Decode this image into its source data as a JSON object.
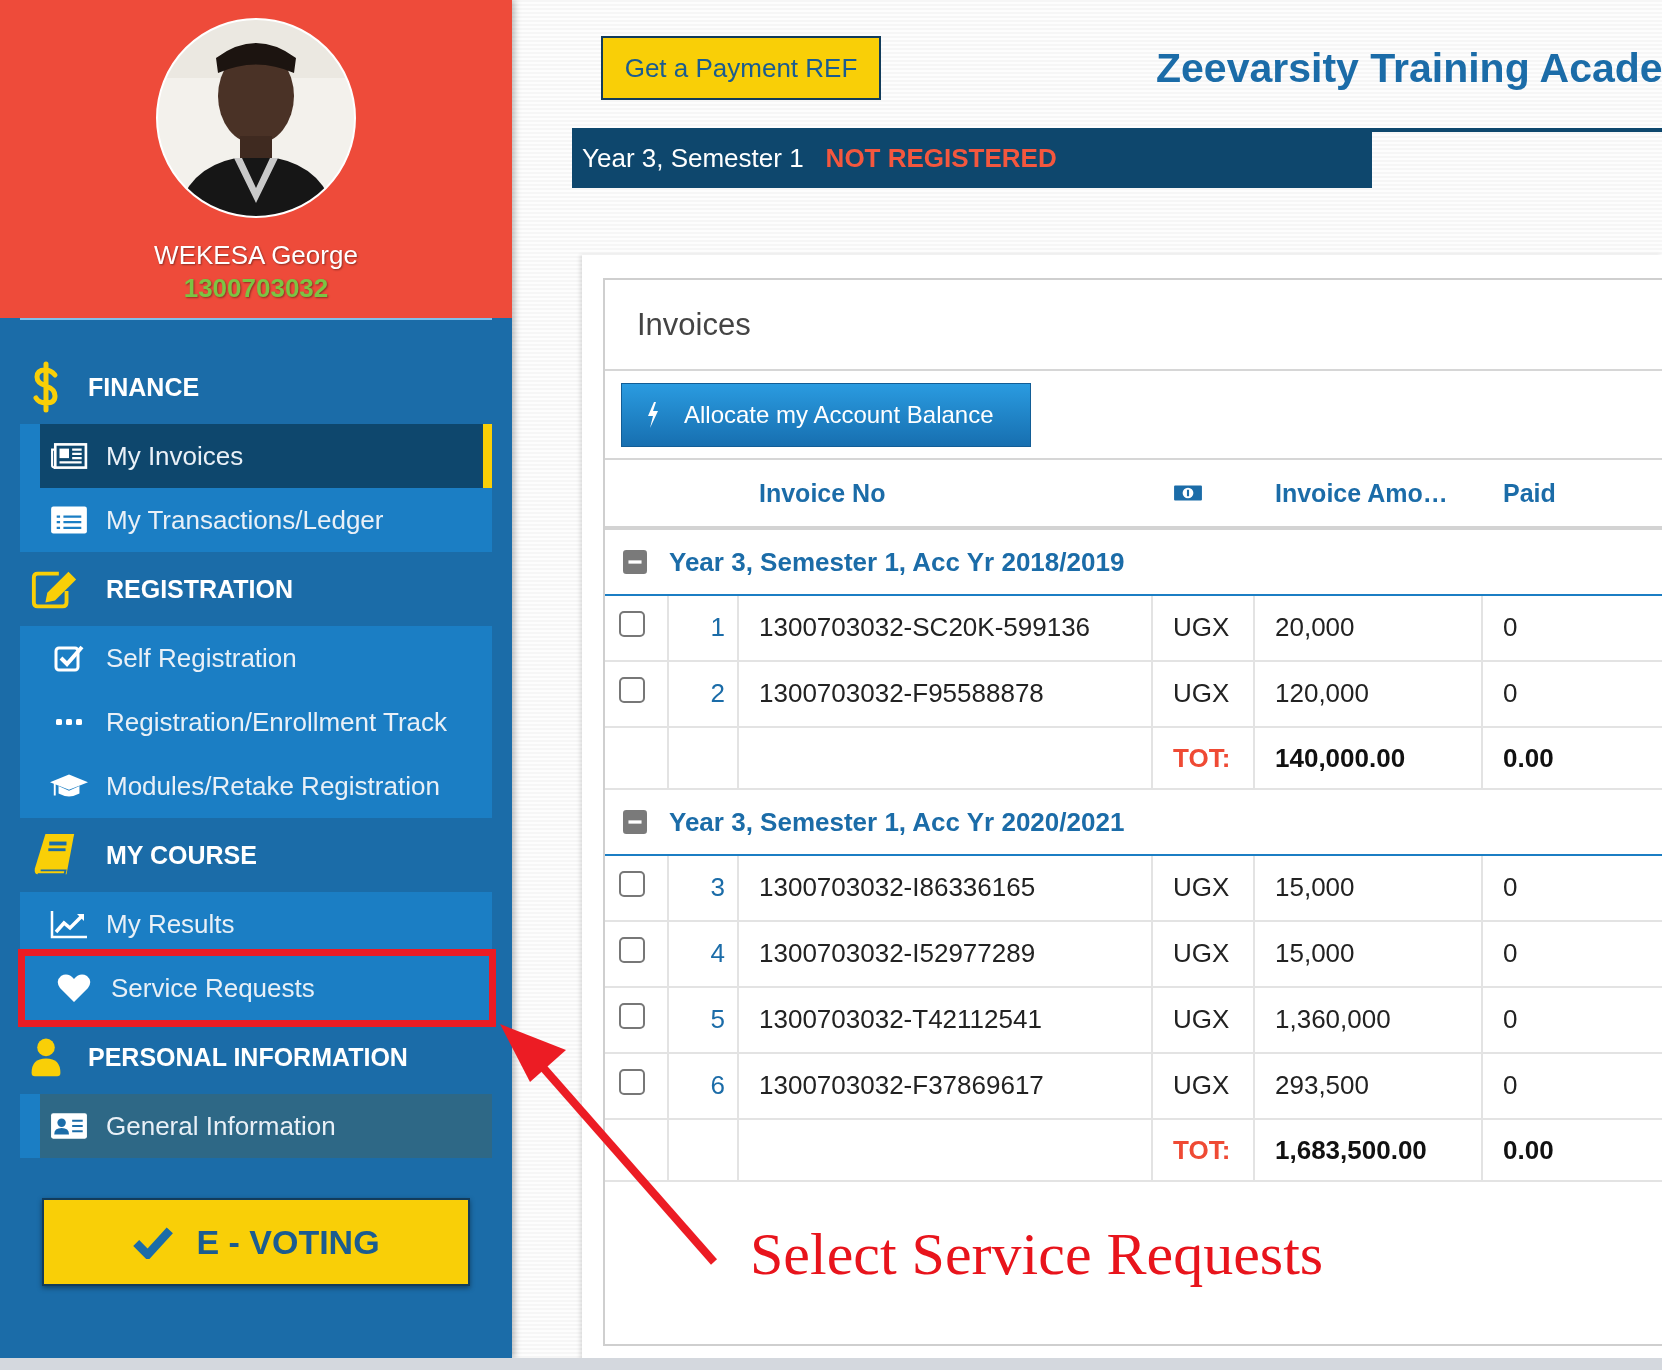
{
  "profile": {
    "name": "WEKESA George",
    "student_no": "1300703032"
  },
  "menu": [
    {
      "heading": "FINANCE",
      "items": [
        {
          "label": "My Invoices",
          "selected": true,
          "hovered": false
        },
        {
          "label": "My Transactions/Ledger",
          "selected": false,
          "hovered": false
        }
      ]
    },
    {
      "heading": "REGISTRATION",
      "items": [
        {
          "label": "Self Registration",
          "selected": false,
          "hovered": false
        },
        {
          "label": "Registration/Enrollment Track",
          "selected": false,
          "hovered": false
        },
        {
          "label": "Modules/Retake Registration",
          "selected": false,
          "hovered": false
        }
      ]
    },
    {
      "heading": "MY COURSE",
      "items": [
        {
          "label": "My Results",
          "selected": false,
          "hovered": false
        },
        {
          "label": "Service Requests",
          "selected": false,
          "hovered": false,
          "annotated": true
        }
      ]
    },
    {
      "heading": "PERSONAL INFORMATION",
      "items": [
        {
          "label": "General Information",
          "selected": false,
          "hovered": true
        }
      ]
    }
  ],
  "evoting_button": "E - VOTING",
  "payment_ref_button": "Get a Payment REF",
  "institution_title": "Zeevarsity Training Acade",
  "status": {
    "period": "Year 3, Semester 1",
    "state": "NOT REGISTERED"
  },
  "invoices": {
    "title": "Invoices",
    "allocate_button": "Allocate my Account Balance",
    "columns": {
      "invoice_no": "Invoice No",
      "amount": "Invoice Amo…",
      "paid": "Paid"
    },
    "groups": [
      {
        "title": "Year 3, Semester 1, Acc Yr 2018/2019",
        "expanded": true,
        "rows": [
          {
            "number": "1",
            "invoice_no": "1300703032-SC20K-599136",
            "currency": "UGX",
            "amount": "20,000",
            "paid": "0",
            "checked": false
          },
          {
            "number": "2",
            "invoice_no": "1300703032-F95588878",
            "currency": "UGX",
            "amount": "120,000",
            "paid": "0",
            "checked": false
          }
        ],
        "total_label": "TOT:",
        "total_amount": "140,000.00",
        "total_paid": "0.00"
      },
      {
        "title": "Year 3, Semester 1, Acc Yr 2020/2021",
        "expanded": true,
        "rows": [
          {
            "number": "3",
            "invoice_no": "1300703032-I86336165",
            "currency": "UGX",
            "amount": "15,000",
            "paid": "0",
            "checked": false
          },
          {
            "number": "4",
            "invoice_no": "1300703032-I52977289",
            "currency": "UGX",
            "amount": "15,000",
            "paid": "0",
            "checked": false
          },
          {
            "number": "5",
            "invoice_no": "1300703032-T42112541",
            "currency": "UGX",
            "amount": "1,360,000",
            "paid": "0",
            "checked": false
          },
          {
            "number": "6",
            "invoice_no": "1300703032-F37869617",
            "currency": "UGX",
            "amount": "293,500",
            "paid": "0",
            "checked": false
          }
        ],
        "total_label": "TOT:",
        "total_amount": "1,683,500.00",
        "total_paid": "0.00"
      }
    ]
  },
  "annotation": {
    "text": "Select Service Requests"
  }
}
